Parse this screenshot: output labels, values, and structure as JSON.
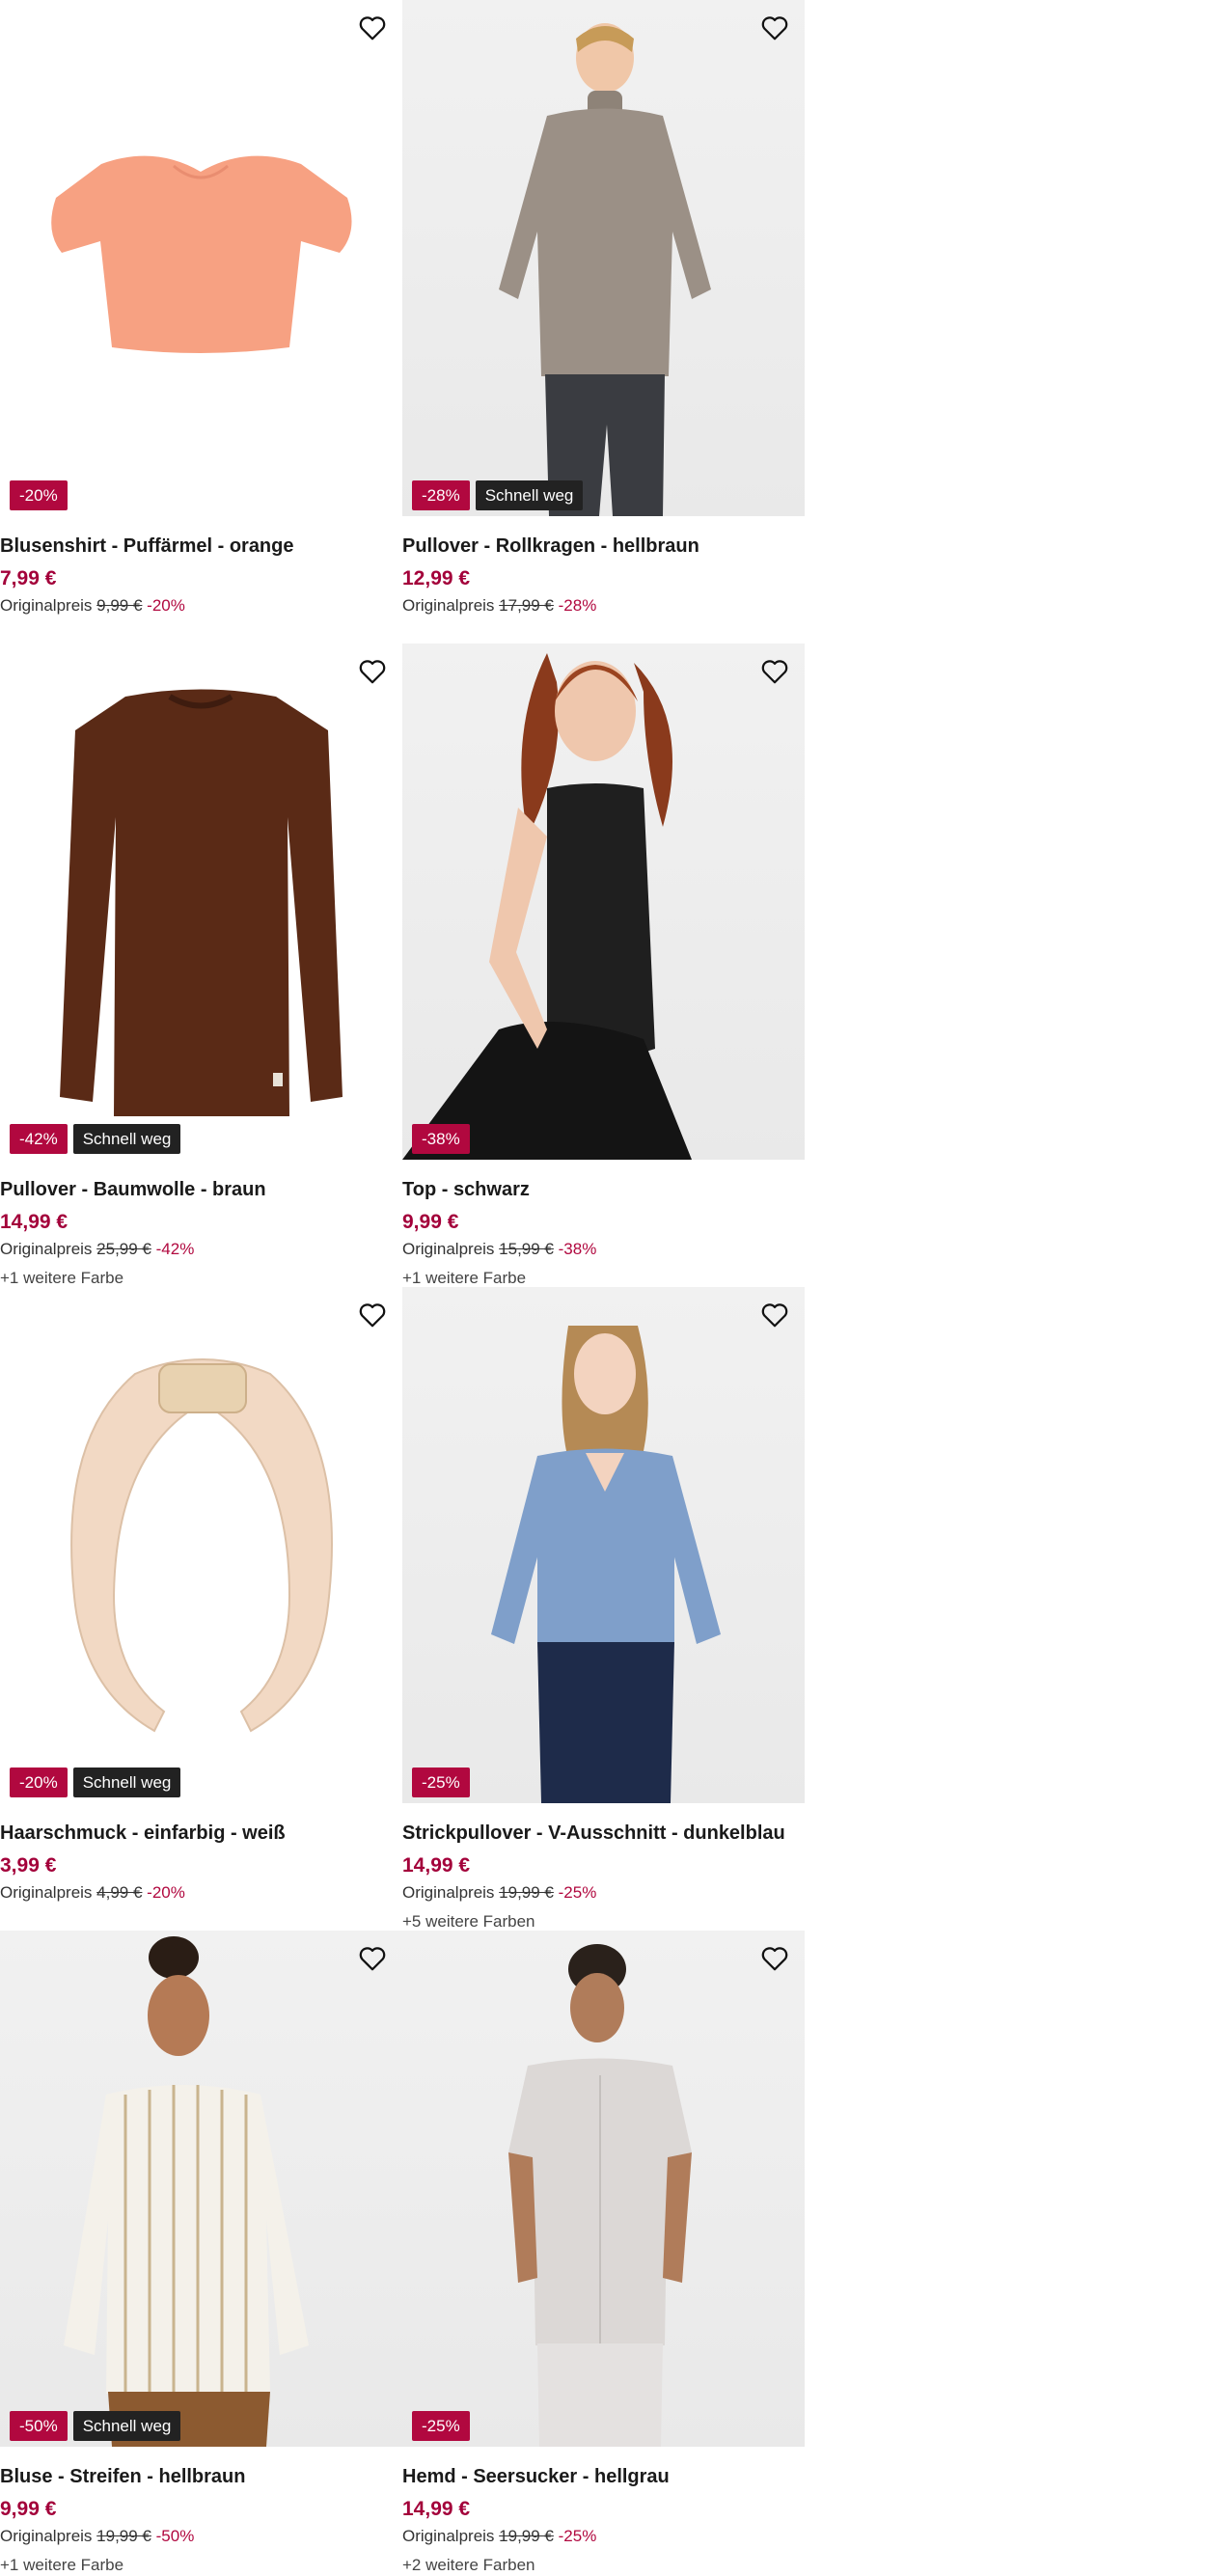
{
  "accent_color": "#b1083f",
  "price_color": "#a3003a",
  "fast_badge_color": "#222222",
  "favorite_icon": "heart-outline-icon",
  "original_price_label": "Originalpreis",
  "products": [
    {
      "title": "Blusenshirt - Puffärmel - orange",
      "price": "7,99 €",
      "original_price": "9,99 €",
      "discount": "-20%",
      "badge_discount": "-20%",
      "badge_fast": "",
      "more_colors": ""
    },
    {
      "title": "Pullover - Rollkragen - hellbraun",
      "price": "12,99 €",
      "original_price": "17,99 €",
      "discount": "-28%",
      "badge_discount": "-28%",
      "badge_fast": "Schnell weg",
      "more_colors": ""
    },
    {
      "title": "Pullover - Baumwolle - braun",
      "price": "14,99 €",
      "original_price": "25,99 €",
      "discount": "-42%",
      "badge_discount": "-42%",
      "badge_fast": "Schnell weg",
      "more_colors": "+1 weitere Farbe"
    },
    {
      "title": "Top - schwarz",
      "price": "9,99 €",
      "original_price": "15,99 €",
      "discount": "-38%",
      "badge_discount": "-38%",
      "badge_fast": "",
      "more_colors": "+1 weitere Farbe"
    },
    {
      "title": "Haarschmuck - einfarbig - weiß",
      "price": "3,99 €",
      "original_price": "4,99 €",
      "discount": "-20%",
      "badge_discount": "-20%",
      "badge_fast": "Schnell weg",
      "more_colors": ""
    },
    {
      "title": "Strickpullover - V-Ausschnitt - dunkelblau",
      "price": "14,99 €",
      "original_price": "19,99 €",
      "discount": "-25%",
      "badge_discount": "-25%",
      "badge_fast": "",
      "more_colors": "+5 weitere Farben"
    },
    {
      "title": "Bluse - Streifen - hellbraun",
      "price": "9,99 €",
      "original_price": "19,99 €",
      "discount": "-50%",
      "badge_discount": "-50%",
      "badge_fast": "Schnell weg",
      "more_colors": "+1 weitere Farbe"
    },
    {
      "title": "Hemd - Seersucker - hellgrau",
      "price": "14,99 €",
      "original_price": "19,99 €",
      "discount": "-25%",
      "badge_discount": "-25%",
      "badge_fast": "",
      "more_colors": "+2 weitere Farben"
    }
  ]
}
